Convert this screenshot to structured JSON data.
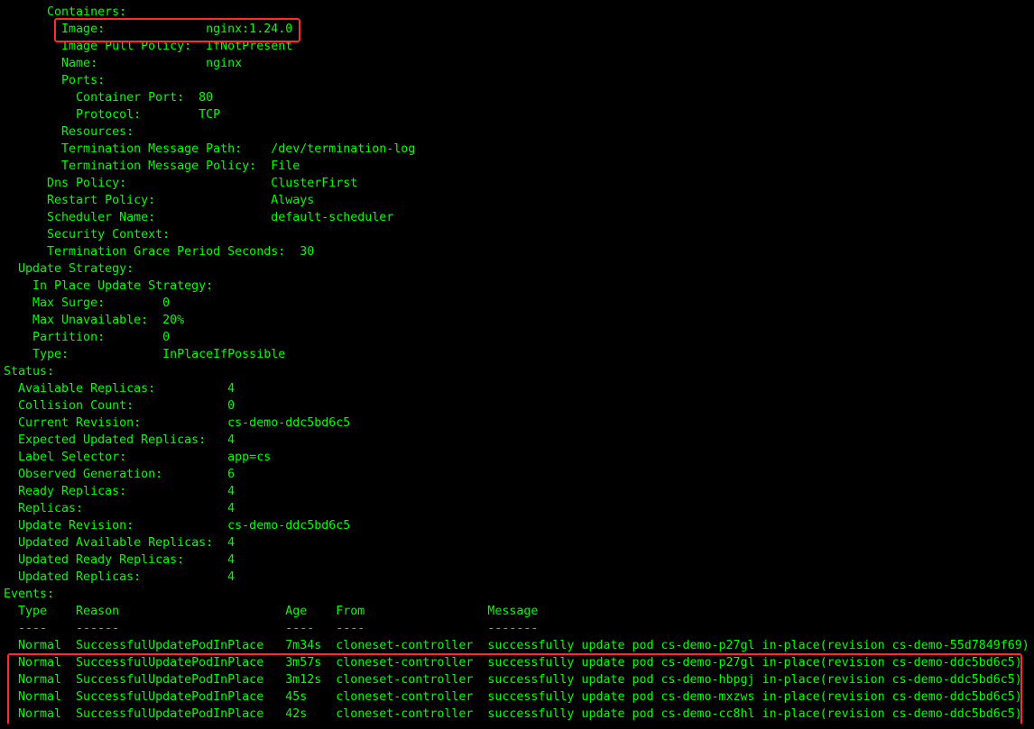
{
  "terminal": {
    "lines": [
      "      Containers:",
      "        Image:              nginx:1.24.0",
      "        Image Pull Policy:  IfNotPresent",
      "        Name:               nginx",
      "        Ports:",
      "          Container Port:  80",
      "          Protocol:        TCP",
      "        Resources:",
      "        Termination Message Path:    /dev/termination-log",
      "        Termination Message Policy:  File",
      "      Dns Policy:                    ClusterFirst",
      "      Restart Policy:                Always",
      "      Scheduler Name:                default-scheduler",
      "      Security Context:",
      "      Termination Grace Period Seconds:  30",
      "  Update Strategy:",
      "    In Place Update Strategy:",
      "    Max Surge:        0",
      "    Max Unavailable:  20%",
      "    Partition:        0",
      "    Type:             InPlaceIfPossible",
      "Status:",
      "  Available Replicas:          4",
      "  Collision Count:             0",
      "  Current Revision:            cs-demo-ddc5bd6c5",
      "  Expected Updated Replicas:   4",
      "  Label Selector:              app=cs",
      "  Observed Generation:         6",
      "  Ready Replicas:              4",
      "  Replicas:                    4",
      "  Update Revision:             cs-demo-ddc5bd6c5",
      "  Updated Available Replicas:  4",
      "  Updated Ready Replicas:      4",
      "  Updated Replicas:            4",
      "Events:",
      "  Type    Reason                       Age    From                 Message",
      "  ----    ------                       ----   ----                 -------",
      "  Normal  SuccessfulUpdatePodInPlace   7m34s  cloneset-controller  successfully update pod cs-demo-p27gl in-place(revision cs-demo-55d7849f69)",
      "  Normal  SuccessfulUpdatePodInPlace   3m57s  cloneset-controller  successfully update pod cs-demo-p27gl in-place(revision cs-demo-ddc5bd6c5)",
      "  Normal  SuccessfulUpdatePodInPlace   3m12s  cloneset-controller  successfully update pod cs-demo-hbpgj in-place(revision cs-demo-ddc5bd6c5)",
      "  Normal  SuccessfulUpdatePodInPlace   45s    cloneset-controller  successfully update pod cs-demo-mxzws in-place(revision cs-demo-ddc5bd6c5)",
      "  Normal  SuccessfulUpdatePodInPlace   42s    cloneset-controller  successfully update pod cs-demo-cc8hl in-place(revision cs-demo-ddc5bd6c5)"
    ]
  },
  "colors": {
    "background": "#000000",
    "text": "#00ff00",
    "highlight_border": "#ff2a2a"
  }
}
